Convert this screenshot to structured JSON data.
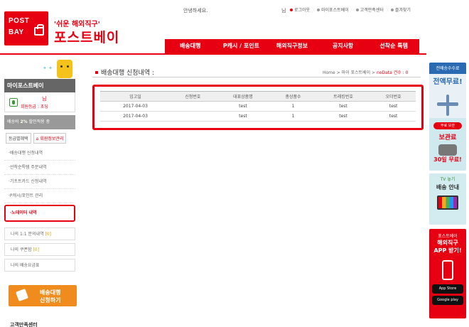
{
  "header": {
    "logo_line1": "POST",
    "logo_line2": "BAY",
    "slogan": "'쉬운 해외직구'",
    "brand": "포스트베이",
    "greeting": "안녕하세요.",
    "user_suffix": "님",
    "top_links": [
      {
        "label": "로그아웃"
      },
      {
        "label": "마이포스트베이"
      },
      {
        "label": "고객만족센터"
      },
      {
        "label": "즐겨찾기"
      }
    ],
    "nav": [
      {
        "label": "배송대행"
      },
      {
        "label": "P캐시 / 포인트"
      },
      {
        "label": "해외직구정보"
      },
      {
        "label": "공지사항"
      },
      {
        "label": "선착순 특템"
      }
    ]
  },
  "sidebar": {
    "title": "마이포스트베이",
    "user_suffix": "님",
    "level": "회원등급 : 초딩",
    "discount_prefix": "배송비",
    "discount_value": "2%",
    "discount_suffix": "할인적용 중",
    "btn_grade": "등급별혜택",
    "btn_member": "회원정보관리",
    "menu": [
      {
        "label": "·배송대행 신청내역"
      },
      {
        "label": "·선착순특템 주문내역"
      },
      {
        "label": "·기프트카드 신청내역"
      },
      {
        "label": "·P캐시/포인트 관리"
      },
      {
        "label": "·노데이터 내역"
      }
    ],
    "box_items": [
      {
        "label": "나의 1:1 문의내역",
        "count": "[0]"
      },
      {
        "label": "나의 쿠폰함",
        "count": "[0]"
      },
      {
        "label": "나의 배송요금표",
        "count": ""
      }
    ],
    "apply_line1": "배송대행",
    "apply_line2": "신청하기",
    "cs_title": "고객만족센터"
  },
  "main": {
    "title": "배송대행 신청내역 :",
    "breadcrumb_home": "Home",
    "breadcrumb_sep1": " > ",
    "breadcrumb_mid": "마이 포스트베이",
    "breadcrumb_sep2": " > ",
    "breadcrumb_current": "noData",
    "breadcrumb_count": " 건수 : 0",
    "table": {
      "headers": [
        "입고일",
        "신청번호",
        "대표상품명",
        "총상품수",
        "트래킹번호",
        "오더번호"
      ],
      "rows": [
        [
          "2017-04-03",
          "",
          "test",
          "1",
          "test",
          "test"
        ],
        [
          "2017-04-03",
          "",
          "test",
          "1",
          "test",
          "test"
        ]
      ]
    }
  },
  "banners": {
    "b1_head": "전배송수수료",
    "b1_big": "전액무료!",
    "b2_tag": "무료 보관",
    "b2_line1": "보관료",
    "b2_line2": "30일 무료!",
    "b3_head": "TV 놓기",
    "b3_title": "배송 안내",
    "b4_head": "포스트베이",
    "b4_line1": "해외직구",
    "b4_line2": "APP 받기!",
    "b4_store1": "App Store",
    "b4_store2": "Google play"
  }
}
